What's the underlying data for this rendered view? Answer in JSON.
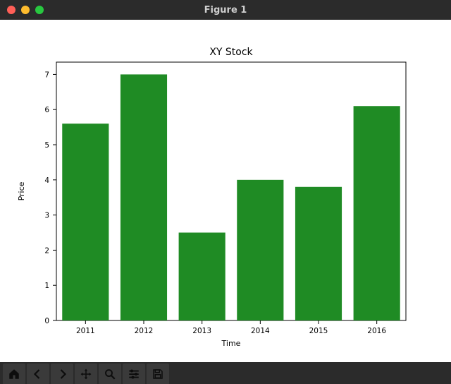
{
  "window": {
    "title": "Figure 1"
  },
  "toolbar": {
    "buttons": [
      {
        "name": "home-icon"
      },
      {
        "name": "back-icon"
      },
      {
        "name": "forward-icon"
      },
      {
        "name": "pan-icon"
      },
      {
        "name": "zoom-icon"
      },
      {
        "name": "configure-icon"
      },
      {
        "name": "save-icon"
      }
    ]
  },
  "chart_data": {
    "type": "bar",
    "title": "XY Stock",
    "xlabel": "Time",
    "ylabel": "Price",
    "categories": [
      "2011",
      "2012",
      "2013",
      "2014",
      "2015",
      "2016"
    ],
    "values": [
      5.6,
      7.0,
      2.5,
      4.0,
      3.8,
      6.1
    ],
    "xlim": [
      0,
      6
    ],
    "ylim": [
      0,
      7.35
    ],
    "yticks": [
      0,
      1,
      2,
      3,
      4,
      5,
      6,
      7
    ],
    "bar_color": "#1f8b24",
    "grid": false,
    "legend": null
  }
}
